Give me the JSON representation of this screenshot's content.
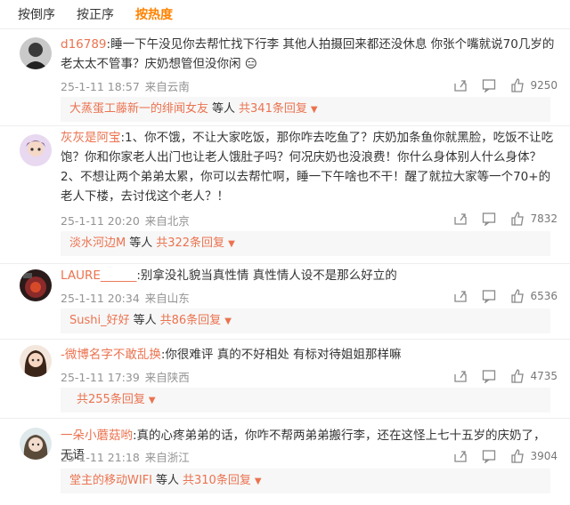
{
  "sort_tabs": [
    {
      "label": "按倒序"
    },
    {
      "label": "按正序"
    },
    {
      "label": "按热度"
    }
  ],
  "comments": [
    {
      "user": "d16789",
      "text": ":睡一下午没见你去帮忙找下行李 其他人拍摄回来都还没休息 你张个嘴就说70几岁的老太太不管事？庆奶想管但没你闲",
      "emoji": "😑",
      "time": "25-1-11 18:57",
      "location": "来自云南",
      "likes": "9250",
      "reply": {
        "user": "大蒸蛋工藤新一的绯闻女友",
        "mid": "等人",
        "count": "共341条回复"
      }
    },
    {
      "user": "灰灰是阿宝",
      "text": ":1、你不饿，不让大家吃饭，那你咋去吃鱼了？庆奶加条鱼你就黑脸，吃饭不让吃饱？你和你家老人出门也让老人饿肚子吗？何况庆奶也没浪费！你什么身体别人什么身体？ 2、不想让两个弟弟太累，你可以去帮忙啊，睡一下午啥也不干！醒了就拉大家等一个70+的老人下楼，去讨伐这个老人？！",
      "time": "25-1-11 20:20",
      "location": "来自北京",
      "likes": "7832",
      "reply": {
        "user": "淡水河边M",
        "mid": "等人",
        "count": "共322条回复"
      }
    },
    {
      "user": "LAURE______",
      "text": ":别拿没礼貌当真性情  真性情人设不是那么好立的",
      "time": "25-1-11 20:34",
      "location": "来自山东",
      "likes": "6536",
      "reply": {
        "user": "Sushi_好好",
        "mid": "等人",
        "count": "共86条回复"
      }
    },
    {
      "user": "-微博名字不敢乱换",
      "text": ":你很难评 真的不好相处 有标对待姐姐那样嘛",
      "time": "25-1-11 17:39",
      "location": "来自陕西",
      "likes": "4735",
      "reply": {
        "user": "",
        "mid": "",
        "count": "共255条回复"
      }
    },
    {
      "user": "一朵小蘑菇哟",
      "text": ":真的心疼弟弟的话，你咋不帮两弟弟搬行李，还在这怪上七十五岁的庆奶了，无语",
      "time": "25-1-11 21:18",
      "location": "来自浙江",
      "likes": "3904",
      "reply": {
        "user": "堂主的移动WIFI",
        "mid": "等人",
        "count": "共310条回复"
      }
    }
  ],
  "colors": {
    "accent": "#ff8200",
    "username": "#eb7350",
    "meta": "#939393",
    "reply_bg": "#f7f7f7"
  },
  "icons": [
    "share-icon",
    "comment-icon",
    "like-icon",
    "chevron-down-icon"
  ]
}
